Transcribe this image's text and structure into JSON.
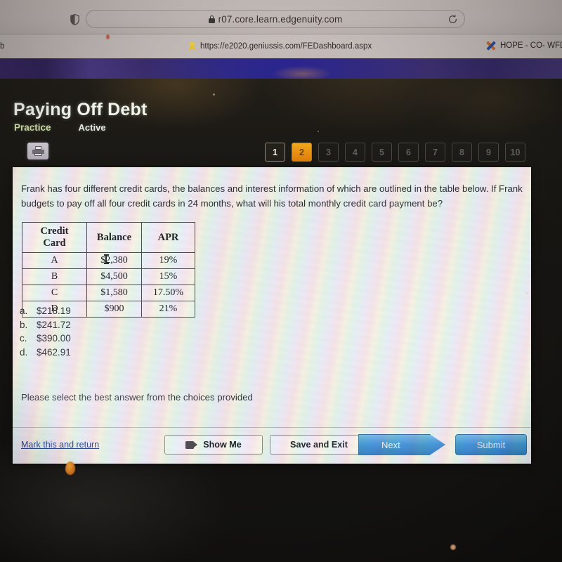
{
  "browser": {
    "shield_icon": "shield-icon",
    "lock_icon": "lock-icon",
    "url": "r07.core.learn.edgenuity.com",
    "reload_icon": "reload-icon",
    "bookmark_favicon": "star-favicon",
    "bookmark_url": "https://e2020.geniussis.com/FEDashboard.aspx",
    "bookmark_left_partial": "b",
    "tab_icon": "excel-x-icon",
    "tab_title": "HOPE - CO- WFD"
  },
  "header": {
    "title": "Paying Off Debt",
    "practice_label": "Practice",
    "status_label": "Active",
    "print_icon": "printer-icon",
    "question_nav": [
      {
        "number": "1",
        "state": "done"
      },
      {
        "number": "2",
        "state": "current"
      },
      {
        "number": "3",
        "state": "todo"
      },
      {
        "number": "4",
        "state": "todo"
      },
      {
        "number": "5",
        "state": "todo"
      },
      {
        "number": "6",
        "state": "todo"
      },
      {
        "number": "7",
        "state": "todo"
      },
      {
        "number": "8",
        "state": "todo"
      },
      {
        "number": "9",
        "state": "todo"
      },
      {
        "number": "10",
        "state": "todo"
      }
    ],
    "accent_current": "#e88f12",
    "accent_done_border": "#c07a42"
  },
  "question": {
    "text": "Frank has four different credit cards, the balances and interest information of which are outlined in the table below.  If Frank budgets to pay off all four credit cards in 24 months, what will his total monthly credit card payment be?",
    "instruction": "Please select the best answer from the choices provided"
  },
  "table": {
    "headers": [
      "Credit Card",
      "Balance",
      "APR"
    ],
    "rows": [
      [
        "A",
        "$2,380",
        "19%"
      ],
      [
        "B",
        "$4,500",
        "15%"
      ],
      [
        "C",
        "$1,580",
        "17.50%"
      ],
      [
        "D",
        "$900",
        "21%"
      ]
    ]
  },
  "choices": [
    {
      "letter": "a.",
      "value": "$218.19"
    },
    {
      "letter": "b.",
      "value": "$241.72"
    },
    {
      "letter": "c.",
      "value": "$390.00"
    },
    {
      "letter": "d.",
      "value": "$462.91"
    }
  ],
  "toolbar": {
    "mark_label": "Mark this and return",
    "show_me_label": "Show Me",
    "show_me_icon": "video-camera-icon",
    "save_exit_label": "Save and Exit",
    "next_label": "Next",
    "submit_label": "Submit",
    "button_blue": "#3d93d6",
    "link_blue": "#1f3f8c"
  }
}
